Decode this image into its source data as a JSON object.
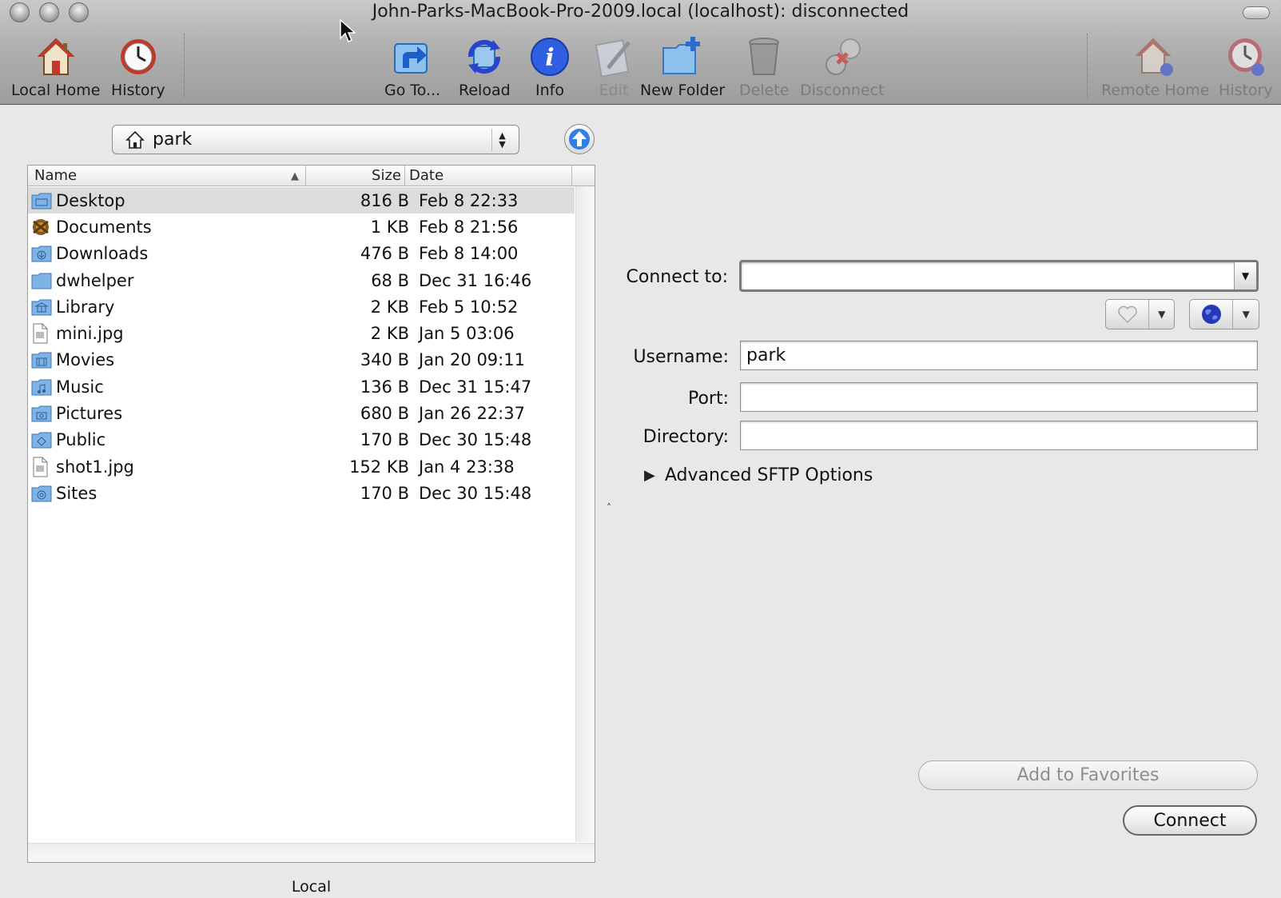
{
  "window": {
    "title": "John-Parks-MacBook-Pro-2009.local (localhost): disconnected"
  },
  "toolbar": {
    "local_home": "Local Home",
    "history_left": "History",
    "go_to": "Go To...",
    "reload": "Reload",
    "info": "Info",
    "edit": "Edit",
    "new_folder": "New Folder",
    "delete": "Delete",
    "disconnect": "Disconnect",
    "remote_home": "Remote Home",
    "history_right": "History"
  },
  "local": {
    "path": "park",
    "columns": {
      "name": "Name",
      "size": "Size",
      "date": "Date"
    },
    "files": [
      {
        "name": "Desktop",
        "size": "816 B",
        "date": "Feb 8 22:33",
        "icon": "folder-desktop-icon"
      },
      {
        "name": "Documents",
        "size": "1 KB",
        "date": "Feb 8 21:56",
        "icon": "folder-documents-icon"
      },
      {
        "name": "Downloads",
        "size": "476 B",
        "date": "Feb 8 14:00",
        "icon": "folder-downloads-icon"
      },
      {
        "name": "dwhelper",
        "size": "68 B",
        "date": "Dec 31 16:46",
        "icon": "folder-icon"
      },
      {
        "name": "Library",
        "size": "2 KB",
        "date": "Feb 5 10:52",
        "icon": "folder-library-icon"
      },
      {
        "name": "mini.jpg",
        "size": "2 KB",
        "date": "Jan 5 03:06",
        "icon": "image-file-icon"
      },
      {
        "name": "Movies",
        "size": "340 B",
        "date": "Jan 20 09:11",
        "icon": "folder-movies-icon"
      },
      {
        "name": "Music",
        "size": "136 B",
        "date": "Dec 31 15:47",
        "icon": "folder-music-icon"
      },
      {
        "name": "Pictures",
        "size": "680 B",
        "date": "Jan 26 22:37",
        "icon": "folder-pictures-icon"
      },
      {
        "name": "Public",
        "size": "170 B",
        "date": "Dec 30 15:48",
        "icon": "folder-public-icon"
      },
      {
        "name": "shot1.jpg",
        "size": "152 KB",
        "date": "Jan 4 23:38",
        "icon": "image-file-icon"
      },
      {
        "name": "Sites",
        "size": "170 B",
        "date": "Dec 30 15:48",
        "icon": "folder-sites-icon"
      }
    ],
    "pane_label": "Local"
  },
  "connect": {
    "connect_to_label": "Connect to:",
    "connect_to_value": "",
    "username_label": "Username:",
    "username_value": "park",
    "port_label": "Port:",
    "port_value": "",
    "directory_label": "Directory:",
    "directory_value": "",
    "advanced_label": "Advanced SFTP Options",
    "add_favorites": "Add to Favorites",
    "connect_button": "Connect"
  },
  "colors": {
    "selection": "#dcdcdc",
    "folder_blue": "#6fa3d9",
    "accent_blue": "#2e6fd6"
  }
}
